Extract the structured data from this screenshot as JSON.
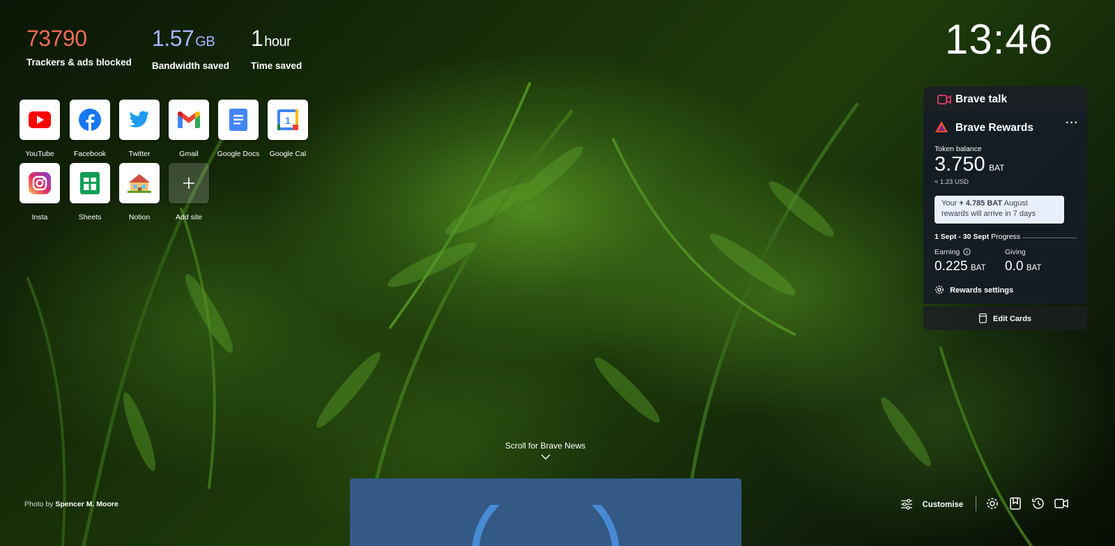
{
  "stats": {
    "trackers": {
      "value": "73790",
      "label": "Trackers & ads blocked",
      "color": "#f26b57"
    },
    "bandwidth": {
      "value": "1.57",
      "unit": "GB",
      "label": "Bandwidth saved",
      "color": "#a8b4ff"
    },
    "time": {
      "value": "1",
      "unit": "hour",
      "label": "Time saved",
      "color": "#ffffff"
    }
  },
  "clock": "13:46",
  "top_sites": [
    {
      "label": "YouTube",
      "icon": "youtube-icon"
    },
    {
      "label": "Facebook",
      "icon": "facebook-icon"
    },
    {
      "label": "Twitter",
      "icon": "twitter-icon"
    },
    {
      "label": "Gmail",
      "icon": "gmail-icon"
    },
    {
      "label": "Google Docs",
      "icon": "google-docs-icon"
    },
    {
      "label": "Google Cal",
      "icon": "google-calendar-icon"
    },
    {
      "label": "Insta",
      "icon": "instagram-icon"
    },
    {
      "label": "Sheets",
      "icon": "google-sheets-icon"
    },
    {
      "label": "Notion",
      "icon": "notion-icon"
    },
    {
      "label": "Add site",
      "icon": "plus-icon"
    }
  ],
  "brave_talk": {
    "title": "Brave talk",
    "icon": "camera-icon",
    "accent": "#e63c6e"
  },
  "rewards": {
    "title": "Brave Rewards",
    "menu": "···",
    "token_label": "Token balance",
    "token_value": "3.750",
    "token_unit": "BAT",
    "usd": "≈ 1.23 USD",
    "notice_prefix": "Your ",
    "notice_amount": "+ 4.785 BAT",
    "notice_suffix": " August rewards will arrive in 7 days",
    "period": "1 Sept - 30 Sept",
    "period_suffix": "Progress",
    "earning_label": "Earning",
    "earning_value": "0.225",
    "earning_unit": "BAT",
    "giving_label": "Giving",
    "giving_value": "0.0",
    "giving_unit": "BAT",
    "settings_label": "Rewards settings"
  },
  "edit_cards": "Edit Cards",
  "scroll_news": "Scroll for Brave News",
  "photo_credit": {
    "prefix": "Photo by",
    "author": "Spencer M. Moore"
  },
  "footer": {
    "customise": "Customise",
    "icons": [
      "settings-icon",
      "bookmarks-icon",
      "history-icon",
      "brave-talk-icon"
    ]
  }
}
